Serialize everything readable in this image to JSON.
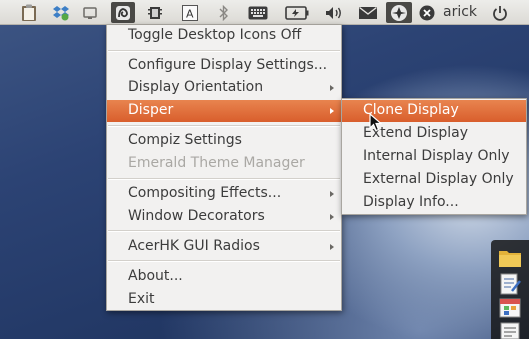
{
  "panel": {
    "user_name": "arick",
    "tray_icons": [
      "clipboard-icon",
      "dropbox-icon",
      "screen-icon",
      "system-tray-icon",
      "chip-icon",
      "text-icon",
      "bluetooth-icon",
      "keyboard-icon",
      "battery-icon",
      "volume-icon",
      "mail-icon",
      "gnome-do-icon",
      "user-status-icon",
      "power-icon"
    ]
  },
  "menu": {
    "items": [
      {
        "label": "Toggle Desktop Icons Off"
      },
      {
        "label": "Configure Display Settings..."
      },
      {
        "label": "Display Orientation"
      },
      {
        "label": "Disper"
      },
      {
        "label": "Compiz Settings"
      },
      {
        "label": "Emerald Theme Manager"
      },
      {
        "label": "Compositing Effects..."
      },
      {
        "label": "Window Decorators"
      },
      {
        "label": "AcerHK GUI Radios"
      },
      {
        "label": "About..."
      },
      {
        "label": "Exit"
      }
    ]
  },
  "submenu": {
    "items": [
      {
        "label": "Clone Display"
      },
      {
        "label": "Extend Display"
      },
      {
        "label": "Internal Display Only"
      },
      {
        "label": "External Display Only"
      },
      {
        "label": "Display Info..."
      }
    ]
  },
  "colors": {
    "selection": "#d95e2c",
    "menu_bg": "#f2f1f0",
    "panel_bg": "#dcdad5"
  }
}
